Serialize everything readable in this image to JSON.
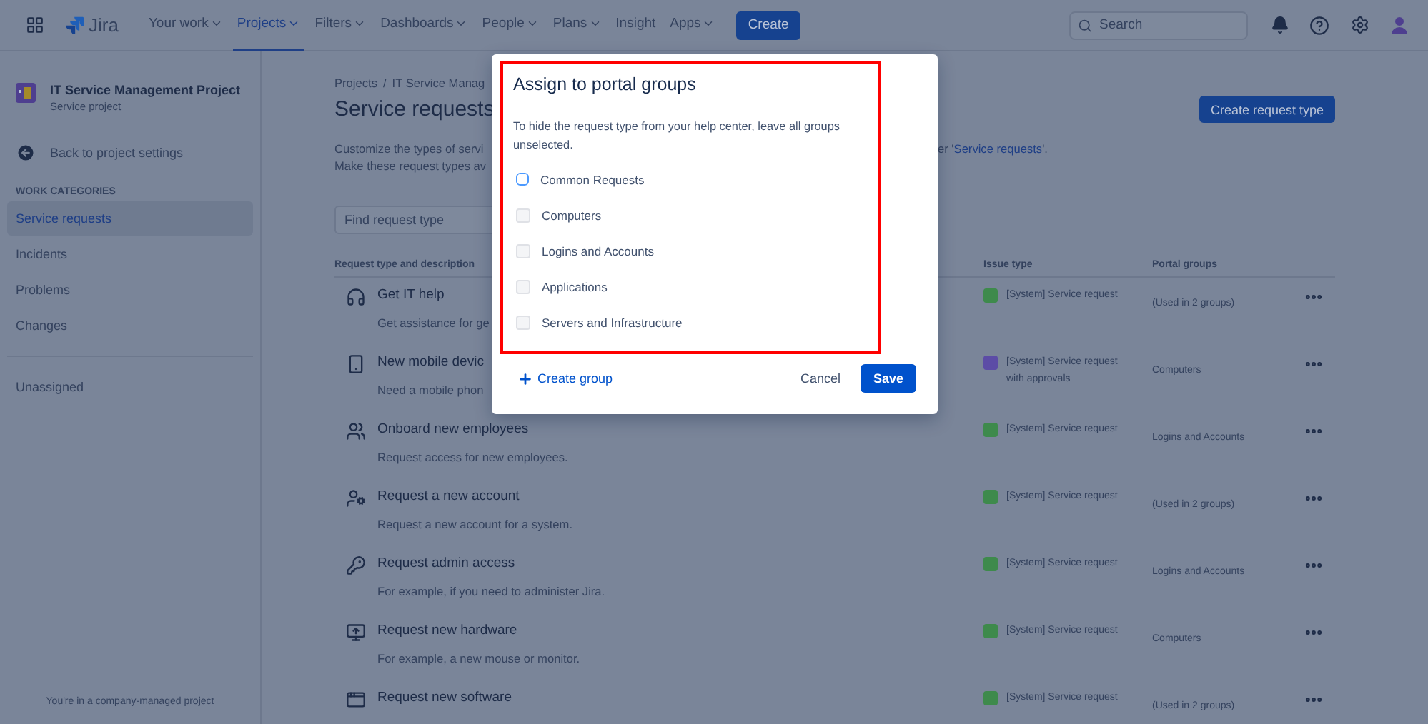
{
  "nav": {
    "logo": "Jira",
    "items": [
      {
        "label": "Your work",
        "dropdown": true,
        "selected": false
      },
      {
        "label": "Projects",
        "dropdown": true,
        "selected": true
      },
      {
        "label": "Filters",
        "dropdown": true,
        "selected": false
      },
      {
        "label": "Dashboards",
        "dropdown": true,
        "selected": false
      },
      {
        "label": "People",
        "dropdown": true,
        "selected": false
      },
      {
        "label": "Plans",
        "dropdown": true,
        "selected": false
      },
      {
        "label": "Insight",
        "dropdown": false,
        "selected": false
      },
      {
        "label": "Apps",
        "dropdown": true,
        "selected": false
      }
    ],
    "create": "Create",
    "search": {
      "placeholder": "Search"
    }
  },
  "sidebar": {
    "project": {
      "name": "IT Service Management Project",
      "type": "Service project"
    },
    "back": "Back to project settings",
    "section": "WORK CATEGORIES",
    "items": [
      {
        "label": "Service requests",
        "selected": true
      },
      {
        "label": "Incidents",
        "selected": false
      },
      {
        "label": "Problems",
        "selected": false
      },
      {
        "label": "Changes",
        "selected": false
      }
    ],
    "other_items": [
      {
        "label": "Unassigned",
        "selected": false
      }
    ],
    "footer": "You're in a company-managed project"
  },
  "main": {
    "breadcrumbs": [
      "Projects",
      "IT Service Manag"
    ],
    "breadcrumb_separator": "/",
    "title": "Service requests",
    "create_button": "Create request type",
    "description": {
      "line_1": "Customize the types of servi",
      "line_1_end": {
        "before": "er '",
        "link": "Service requests",
        "after": "'."
      },
      "line_2": "Make these request types av"
    },
    "search": {
      "placeholder": "Find request type"
    },
    "columns": [
      "Request type and description",
      "Issue type",
      "Portal groups"
    ],
    "rows": [
      {
        "kind": "headset",
        "name": "Get IT help",
        "description": "Get assistance for ge",
        "issue_type": "[System] Service request",
        "color": "#3e8a4c",
        "portal_groups": "(Used in 2 groups)"
      },
      {
        "kind": "phone",
        "name": "New mobile devic",
        "description": "Need a mobile phon",
        "issue_type": "[System] Service request with approvals",
        "color": "#5c4ca6",
        "portal_groups": "Computers"
      },
      {
        "kind": "people",
        "name": "Onboard new employees",
        "description": "Request access for new employees.",
        "issue_type": "[System] Service request",
        "color": "#3e8a4c",
        "portal_groups": "Logins and Accounts"
      },
      {
        "kind": "account",
        "name": "Request a new account",
        "description": "Request a new account for a system.",
        "issue_type": "[System] Service request",
        "color": "#3e8a4c",
        "portal_groups": "(Used in 2 groups)"
      },
      {
        "kind": "key",
        "name": "Request admin access",
        "description": "For example, if you need to administer Jira.",
        "issue_type": "[System] Service request",
        "color": "#3e8a4c",
        "portal_groups": "Logins and Accounts"
      },
      {
        "kind": "monitor",
        "name": "Request new hardware",
        "description": "For example, a new mouse or monitor.",
        "issue_type": "[System] Service request",
        "color": "#3e8a4c",
        "portal_groups": "Computers"
      },
      {
        "kind": "app",
        "name": "Request new software",
        "issue_type": "[System] Service request",
        "color": "#3e8a4c",
        "portal_groups": "(Used in 2 groups)"
      }
    ]
  },
  "dialog": {
    "title": "Assign to portal groups",
    "text": "To hide the request type from your help center, leave all groups unselected.",
    "groups": [
      {
        "label": "Common Requests",
        "checked": false,
        "focused": true
      },
      {
        "label": "Computers",
        "checked": false,
        "focused": false
      },
      {
        "label": "Logins and Accounts",
        "checked": false,
        "focused": false
      },
      {
        "label": "Applications",
        "checked": false,
        "focused": false
      },
      {
        "label": "Servers and Infrastructure",
        "checked": false,
        "focused": false
      }
    ],
    "create_group": "Create group",
    "cancel": "Cancel",
    "save": "Save"
  }
}
